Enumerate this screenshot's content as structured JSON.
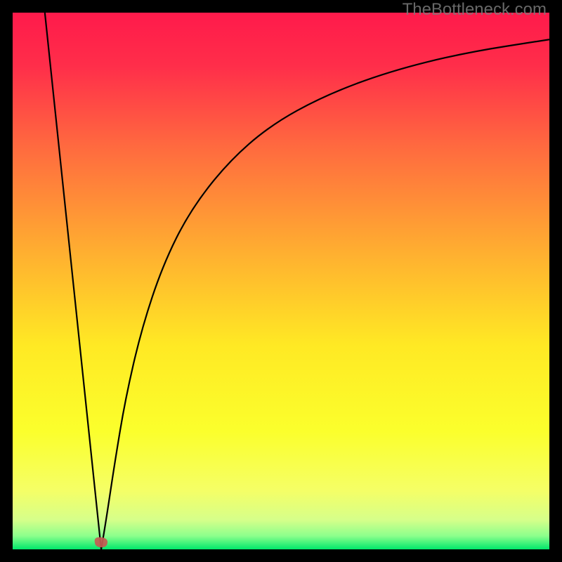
{
  "watermark": "TheBottleneck.com",
  "chart_data": {
    "type": "line",
    "title": "",
    "xlabel": "",
    "ylabel": "",
    "xlim": [
      0,
      100
    ],
    "ylim": [
      0,
      100
    ],
    "background_gradient": {
      "stops": [
        {
          "offset": 0.0,
          "color": "#ff1a4b"
        },
        {
          "offset": 0.1,
          "color": "#ff2e4a"
        },
        {
          "offset": 0.25,
          "color": "#ff6a3f"
        },
        {
          "offset": 0.45,
          "color": "#ffb030"
        },
        {
          "offset": 0.62,
          "color": "#ffe924"
        },
        {
          "offset": 0.78,
          "color": "#fbff2c"
        },
        {
          "offset": 0.89,
          "color": "#f5ff66"
        },
        {
          "offset": 0.945,
          "color": "#d6ff8a"
        },
        {
          "offset": 0.975,
          "color": "#8cff8c"
        },
        {
          "offset": 1.0,
          "color": "#00e76b"
        }
      ]
    },
    "marker": {
      "x": 16.5,
      "y": 1.2,
      "color": "#c45a52"
    },
    "series": [
      {
        "name": "curve",
        "color": "#000000",
        "branch_left": {
          "x0": 6.0,
          "y0": 100.0,
          "x1": 16.5,
          "y1": 0.0
        },
        "branch_right_points": [
          {
            "x": 16.5,
            "y": 0.0
          },
          {
            "x": 17.5,
            "y": 6.0
          },
          {
            "x": 19.0,
            "y": 16.0
          },
          {
            "x": 21.0,
            "y": 28.0
          },
          {
            "x": 24.0,
            "y": 41.0
          },
          {
            "x": 28.0,
            "y": 53.0
          },
          {
            "x": 33.0,
            "y": 63.0
          },
          {
            "x": 40.0,
            "y": 72.0
          },
          {
            "x": 48.0,
            "y": 79.0
          },
          {
            "x": 58.0,
            "y": 84.5
          },
          {
            "x": 70.0,
            "y": 89.0
          },
          {
            "x": 84.0,
            "y": 92.5
          },
          {
            "x": 100.0,
            "y": 95.0
          }
        ]
      }
    ]
  }
}
